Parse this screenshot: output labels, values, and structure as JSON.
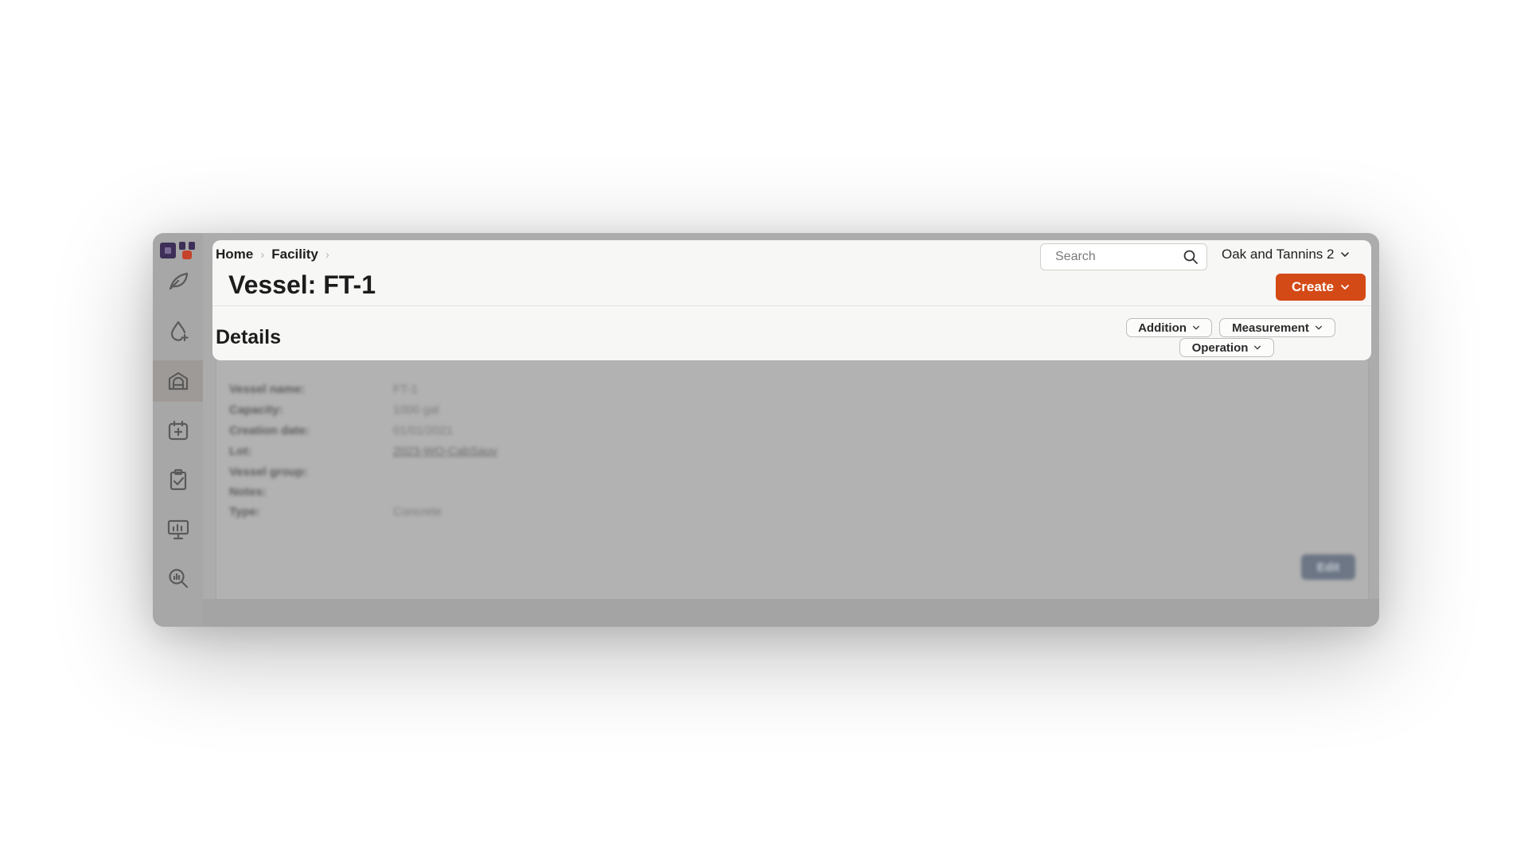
{
  "breadcrumb": {
    "items": [
      "Home",
      "Facility"
    ]
  },
  "page": {
    "title": "Vessel: FT-1"
  },
  "section": {
    "heading": "Details"
  },
  "search": {
    "placeholder": "Search"
  },
  "org": {
    "name": "Oak and Tannins 2"
  },
  "actions": {
    "create_label": "Create",
    "addition_label": "Addition",
    "measurement_label": "Measurement",
    "operation_label": "Operation",
    "edit_label": "Edit"
  },
  "details": [
    {
      "label": "Vessel name:",
      "value": "FT-1"
    },
    {
      "label": "Capacity:",
      "value": "1000 gal"
    },
    {
      "label": "Creation date:",
      "value": "01/01/2021"
    },
    {
      "label": "Lot:",
      "value": "2023-WO-CabSauv"
    },
    {
      "label": "Vessel group:",
      "value": ""
    },
    {
      "label": "Notes:",
      "value": ""
    },
    {
      "label": "Type:",
      "value": "Concrete"
    }
  ],
  "sidebar": {
    "items": [
      {
        "icon": "leaf-icon"
      },
      {
        "icon": "drop-add-icon"
      },
      {
        "icon": "facility-icon",
        "active": true
      },
      {
        "icon": "calendar-icon"
      },
      {
        "icon": "clipboard-check-icon"
      },
      {
        "icon": "monitor-chart-icon"
      },
      {
        "icon": "search-report-icon"
      }
    ]
  },
  "colors": {
    "accent": "#d44a17",
    "panel": "#f7f7f5",
    "overlay": "#acacac"
  }
}
